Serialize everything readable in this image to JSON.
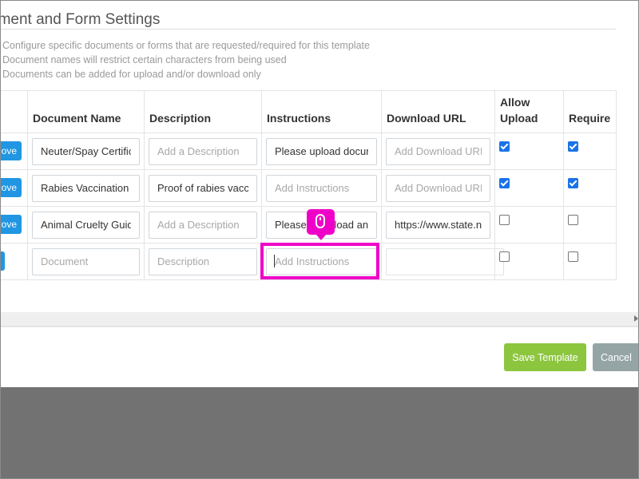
{
  "section": {
    "title": "ument and Form Settings",
    "notes": [
      "Configure specific documents or forms that are requested/required for this template",
      "Document names will restrict certain characters from being used",
      "Documents can be added for upload and/or download only"
    ]
  },
  "table": {
    "headers": {
      "name": "Document Name",
      "description": "Description",
      "instructions": "Instructions",
      "download_url": "Download URL",
      "allow_upload_1": "Allow",
      "allow_upload_2": "Upload",
      "required": "Require"
    },
    "remove_label": "ove",
    "rows": [
      {
        "name": "Neuter/Spay Certificate",
        "description": "",
        "description_placeholder": "Add a Description",
        "instructions": "Please upload document",
        "instructions_placeholder": "Add Instructions",
        "download_url": "",
        "download_url_placeholder": "Add Download URL",
        "allow_upload": true,
        "required": true
      },
      {
        "name": "Rabies Vaccination Certificate",
        "description": "Proof of rabies vaccination",
        "description_placeholder": "Add a Description",
        "instructions": "",
        "instructions_placeholder": "Add Instructions",
        "download_url": "",
        "download_url_placeholder": "Add Download URL",
        "allow_upload": true,
        "required": true
      },
      {
        "name": "Animal Cruelty Guidelines",
        "description": "",
        "description_placeholder": "Add a Description",
        "instructions": "Please download and",
        "instructions_placeholder": "Add Instructions",
        "download_url": "https://www.state.n",
        "download_url_placeholder": "Add Download URL",
        "allow_upload": false,
        "required": false
      }
    ],
    "new_row": {
      "name_placeholder": "Document",
      "description_placeholder": "Description",
      "instructions_placeholder": "Add Instructions",
      "download_url": "",
      "allow_upload": false,
      "required": false
    }
  },
  "footer": {
    "save_label": "Save Template",
    "cancel_label": "Cancel"
  },
  "colors": {
    "primary_blue": "#2196e3",
    "save_green": "#8cc63f",
    "cancel_gray": "#95a5a6",
    "highlight_magenta": "#ef00c8",
    "overlay_gray": "#727272"
  }
}
